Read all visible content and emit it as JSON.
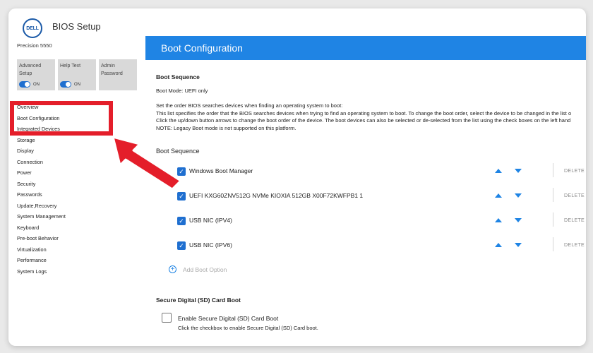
{
  "header": {
    "logo_text": "DELL",
    "app_title": "BIOS Setup",
    "model": "Precision 5550"
  },
  "tiles": [
    {
      "label": "Advanced Setup",
      "toggle": "ON"
    },
    {
      "label": "Help Text",
      "toggle": "ON"
    },
    {
      "label": "Admin Password"
    }
  ],
  "sidebar": {
    "items": [
      {
        "label": "Overview"
      },
      {
        "label": "Boot Configuration",
        "active": true
      },
      {
        "label": "Integrated Devices"
      },
      {
        "label": "Storage"
      },
      {
        "label": "Display"
      },
      {
        "label": "Connection"
      },
      {
        "label": "Power"
      },
      {
        "label": "Security"
      },
      {
        "label": "Passwords"
      },
      {
        "label": "Update,Recovery"
      },
      {
        "label": "System Management"
      },
      {
        "label": "Keyboard"
      },
      {
        "label": "Pre-boot Behavior"
      },
      {
        "label": "Virtualization"
      },
      {
        "label": "Performance"
      },
      {
        "label": "System Logs"
      }
    ]
  },
  "main": {
    "banner_title": "Boot Configuration",
    "section1_title": "Boot Sequence",
    "boot_mode": "Boot Mode: UEFI only",
    "description": [
      "Set the order BIOS searches devices when finding an operating system to boot:",
      "This list specifies the order that the BIOS searches devices when trying to find an operating system to boot.  To change the boot order, select the device to be changed in the list o",
      "Click the up/down button arrows to change the boot order of the device.  The boot devices can also be selected or de-selected from the list using the check boxes on the left hand",
      "NOTE: Legacy Boot mode is not supported on this platform."
    ],
    "list_title": "Boot Sequence",
    "boot_items": [
      {
        "name": "Windows Boot Manager",
        "checked": true,
        "delete_label": "DELETE"
      },
      {
        "name": "UEFI KXG60ZNV512G NVMe KIOXIA 512GB X00F72KWFPB1 1",
        "checked": true,
        "delete_label": "DELETE"
      },
      {
        "name": "USB NIC (IPV4)",
        "checked": true,
        "delete_label": "DELETE"
      },
      {
        "name": "USB NIC (IPV6)",
        "checked": true,
        "delete_label": "DELETE"
      }
    ],
    "add_boot_option": "Add Boot Option",
    "sd_section_title": "Secure Digital (SD) Card Boot",
    "sd_checkbox_label": "Enable Secure Digital (SD) Card Boot",
    "sd_help": "Click the checkbox to enable Secure Digital (SD) Card boot.",
    "sd_checked": false
  },
  "annotation": {
    "highlight_color": "#e41e2a"
  },
  "colors": {
    "accent": "#1f84e4",
    "toggle": "#1f6fd0",
    "active_indicator": "#6a2c9a"
  }
}
